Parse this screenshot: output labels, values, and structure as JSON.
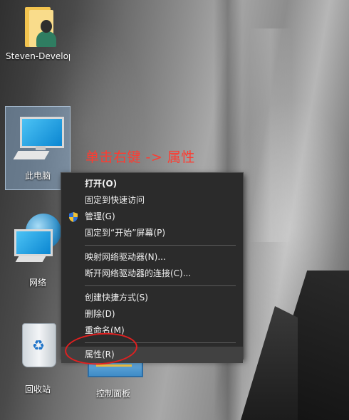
{
  "desktop": {
    "icons": [
      {
        "label": "Steven-Develop…"
      },
      {
        "label": "此电脑"
      },
      {
        "label": "网络"
      },
      {
        "label": "回收站"
      },
      {
        "label": "控制面板"
      }
    ]
  },
  "annotation": {
    "text": "单击右键 -> 属性",
    "color": "#ff3b30"
  },
  "context_menu": {
    "items": [
      {
        "label": "打开(O)"
      },
      {
        "label": "固定到快速访问"
      },
      {
        "label": "管理(G)",
        "icon": "uac-shield-icon"
      },
      {
        "label": "固定到“开始”屏幕(P)"
      },
      {
        "label": "映射网络驱动器(N)..."
      },
      {
        "label": "断开网络驱动器的连接(C)..."
      },
      {
        "label": "创建快捷方式(S)"
      },
      {
        "label": "删除(D)"
      },
      {
        "label": "重命名(M)"
      },
      {
        "label": "属性(R)"
      }
    ],
    "highlight_color": "#e02020"
  }
}
